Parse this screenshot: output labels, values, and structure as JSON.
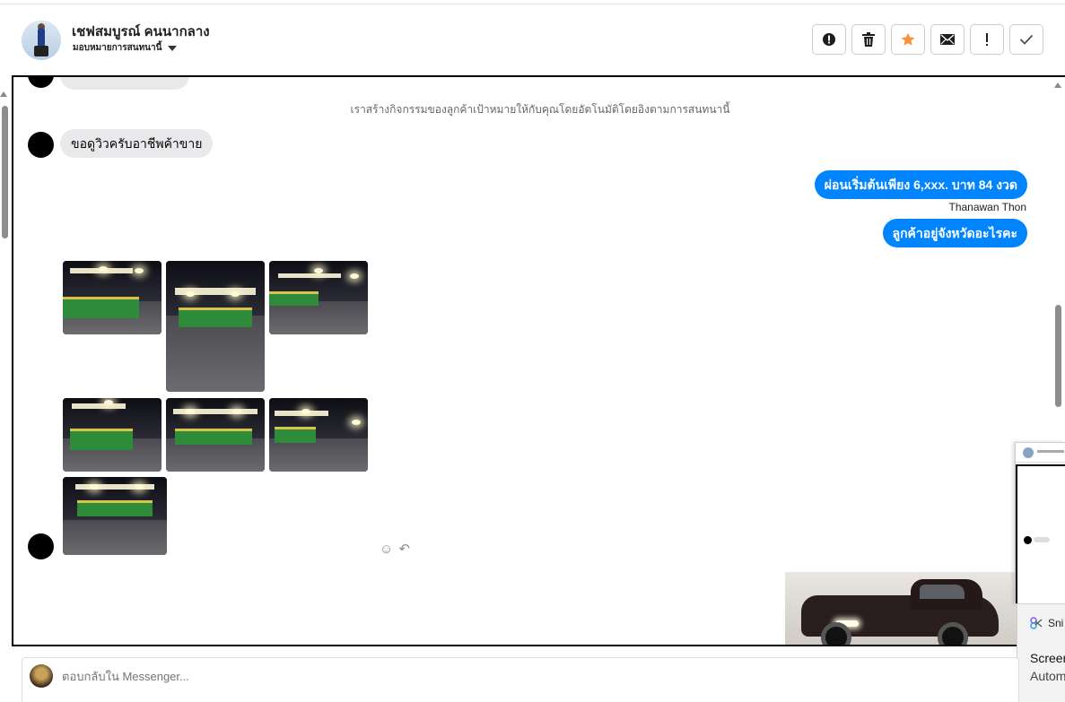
{
  "header": {
    "contact_name": "เชฟสมบูรณ์ คนนากลาง",
    "assign_label": "มอบหมายการสนทนานี้",
    "actions": [
      {
        "name": "spam-button",
        "icon": "alert-circle-icon"
      },
      {
        "name": "delete-button",
        "icon": "trash-icon"
      },
      {
        "name": "star-button",
        "icon": "star-icon"
      },
      {
        "name": "mark-unread-button",
        "icon": "envelope-icon"
      },
      {
        "name": "follow-up-button",
        "icon": "exclamation-icon"
      },
      {
        "name": "done-button",
        "icon": "check-icon"
      }
    ],
    "star_color": "#f7923a"
  },
  "chat": {
    "system_note": "เราสร้างกิจกรรมของลูกค้าเป้าหมายให้กับคุณโดยอัตโนมัติโดยอิงตามการสนทนานี้",
    "incoming_message": "ขอดูวิวครับอาชีพค้าขาย",
    "outgoing_messages": [
      "ผ่อนเริ่มต้นเพียง 6,xxx. บาท 84 งวด",
      "ลูกค้าอยู่จังหวัดอะไรคะ"
    ],
    "outgoing_sender": "Thanawan Thon",
    "bubble_color": "#0084ff",
    "photo_count": 7
  },
  "composer": {
    "placeholder": "ตอบกลับใน Messenger..."
  },
  "toast": {
    "app": "Sni",
    "title": "Screen",
    "body": "Autom"
  }
}
